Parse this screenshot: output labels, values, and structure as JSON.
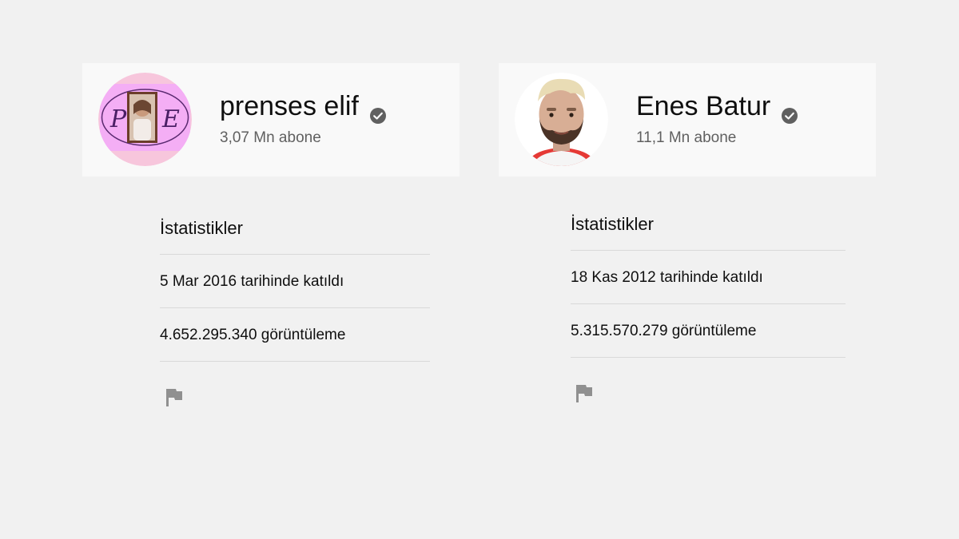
{
  "channels": [
    {
      "name": "prenses elif",
      "subscribers": "3,07 Mn abone",
      "avatar_monogram_left": "P",
      "avatar_monogram_right": "E",
      "stats_title": "İstatistikler",
      "joined": "5 Mar 2016 tarihinde katıldı",
      "views": "4.652.295.340 görüntüleme"
    },
    {
      "name": "Enes Batur",
      "subscribers": "11,1 Mn abone",
      "stats_title": "İstatistikler",
      "joined": "18 Kas 2012 tarihinde katıldı",
      "views": "5.315.570.279 görüntüleme"
    }
  ],
  "icons": {
    "verified": "verified-check-icon",
    "report": "flag-icon"
  },
  "colors": {
    "background": "#f1f1f1",
    "card": "#f9f9f9",
    "verified": "#606060",
    "flag": "#909090"
  }
}
